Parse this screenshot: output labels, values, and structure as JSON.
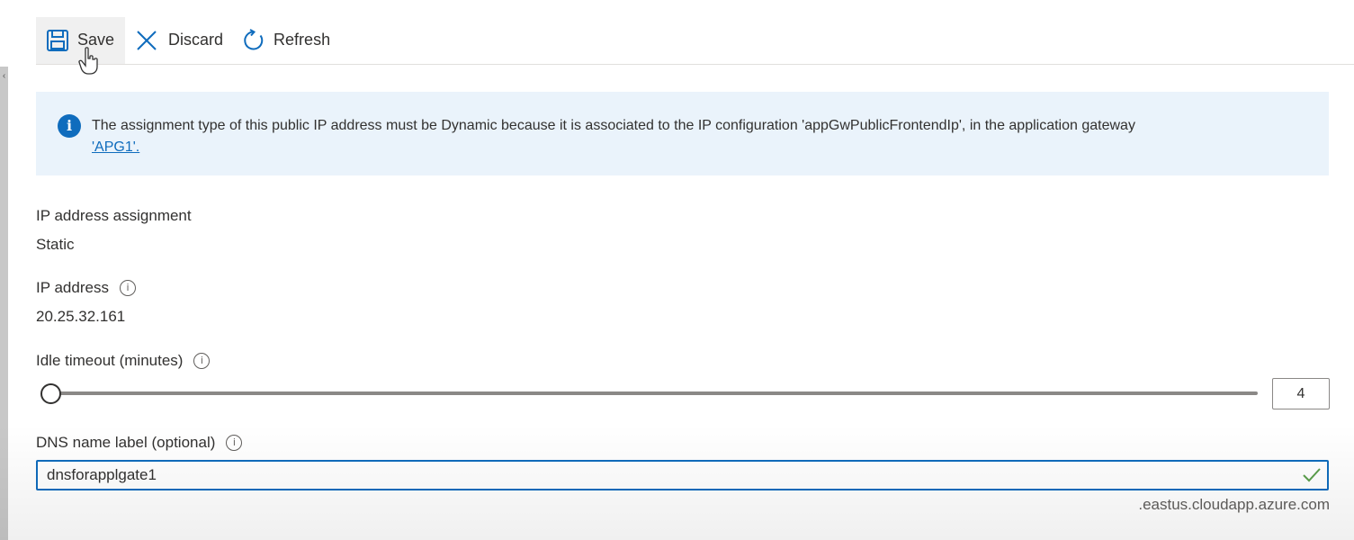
{
  "toolbar": {
    "save_label": "Save",
    "discard_label": "Discard",
    "refresh_label": "Refresh"
  },
  "banner": {
    "message": "The assignment type of this public IP address must be Dynamic because it is associated to the IP configuration 'appGwPublicFrontendIp', in the application gateway",
    "link_text": "'APG1'."
  },
  "ip_assignment": {
    "label": "IP address assignment",
    "value": "Static"
  },
  "ip_address": {
    "label": "IP address",
    "value": "20.25.32.161"
  },
  "idle_timeout": {
    "label": "Idle timeout (minutes)",
    "value": "4",
    "slider_level": 0
  },
  "dns": {
    "label": "DNS name label (optional)",
    "value": "dnsforapplgate1",
    "suffix": ".eastus.cloudapp.azure.com"
  },
  "colors": {
    "accent": "#0f6cbd",
    "banner_bg": "#eaf3fb"
  }
}
